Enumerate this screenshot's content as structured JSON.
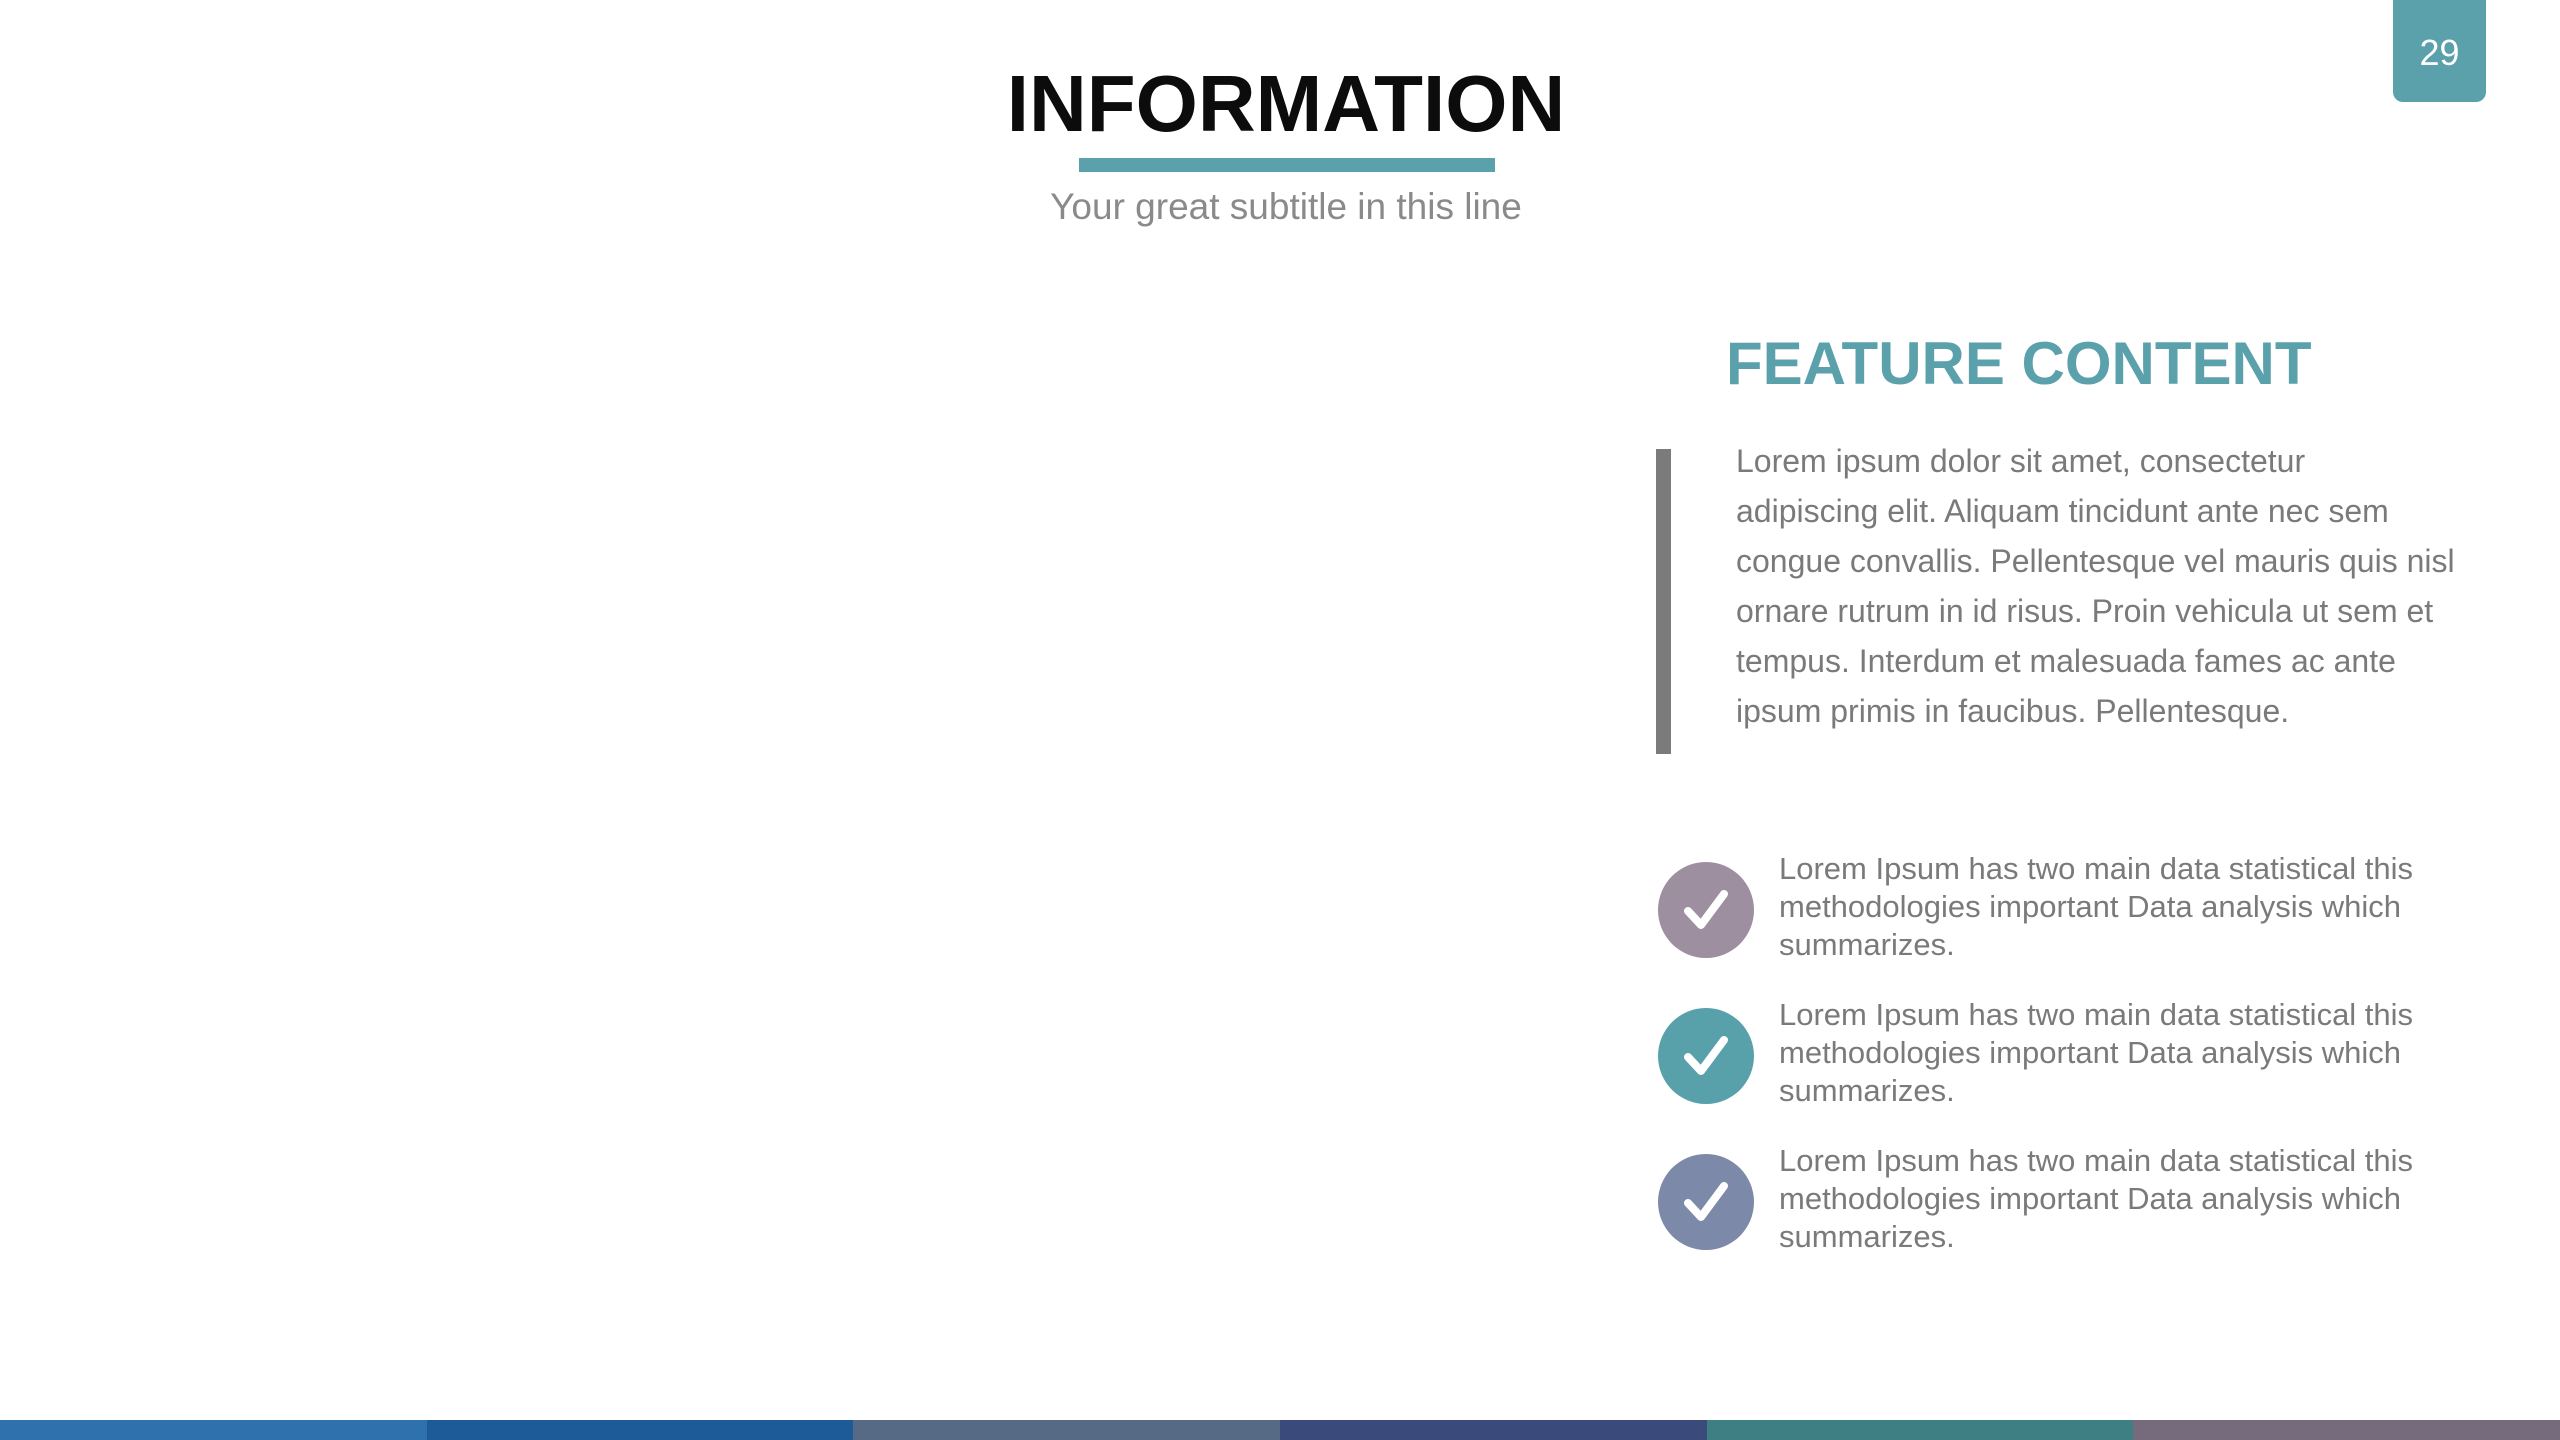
{
  "page": {
    "number": "29"
  },
  "header": {
    "title": "INFORMATION",
    "subtitle": "Your great subtitle in this line"
  },
  "feature": {
    "heading": "FEATURE CONTENT",
    "body": "Lorem ipsum dolor sit amet, consectetur adipiscing elit. Aliquam tincidunt ante nec sem congue convallis. Pellentesque vel mauris quis nisl ornare rutrum in id risus. Proin vehicula ut sem et tempus. Interdum et malesuada fames ac ante ipsum primis in faucibus. Pellentesque."
  },
  "checklist": [
    {
      "icon": "checkmark-icon",
      "color": "#9d8ea0",
      "text": "Lorem Ipsum has two main data statistical this methodologies important Data analysis which summarizes."
    },
    {
      "icon": "checkmark-icon",
      "color": "#58a1ab",
      "text": "Lorem Ipsum has two main data statistical this methodologies important Data analysis which summarizes."
    },
    {
      "icon": "checkmark-icon",
      "color": "#7d89a8",
      "text": "Lorem Ipsum has two main data statistical this methodologies important Data analysis which summarizes."
    }
  ],
  "colors": {
    "accent": "#5ba1ac",
    "quote_bar": "#7b7b7b",
    "footer": [
      "#2f71ad",
      "#1d5a98",
      "#566a86",
      "#394a7b",
      "#3e7f83",
      "#766a7d"
    ]
  }
}
